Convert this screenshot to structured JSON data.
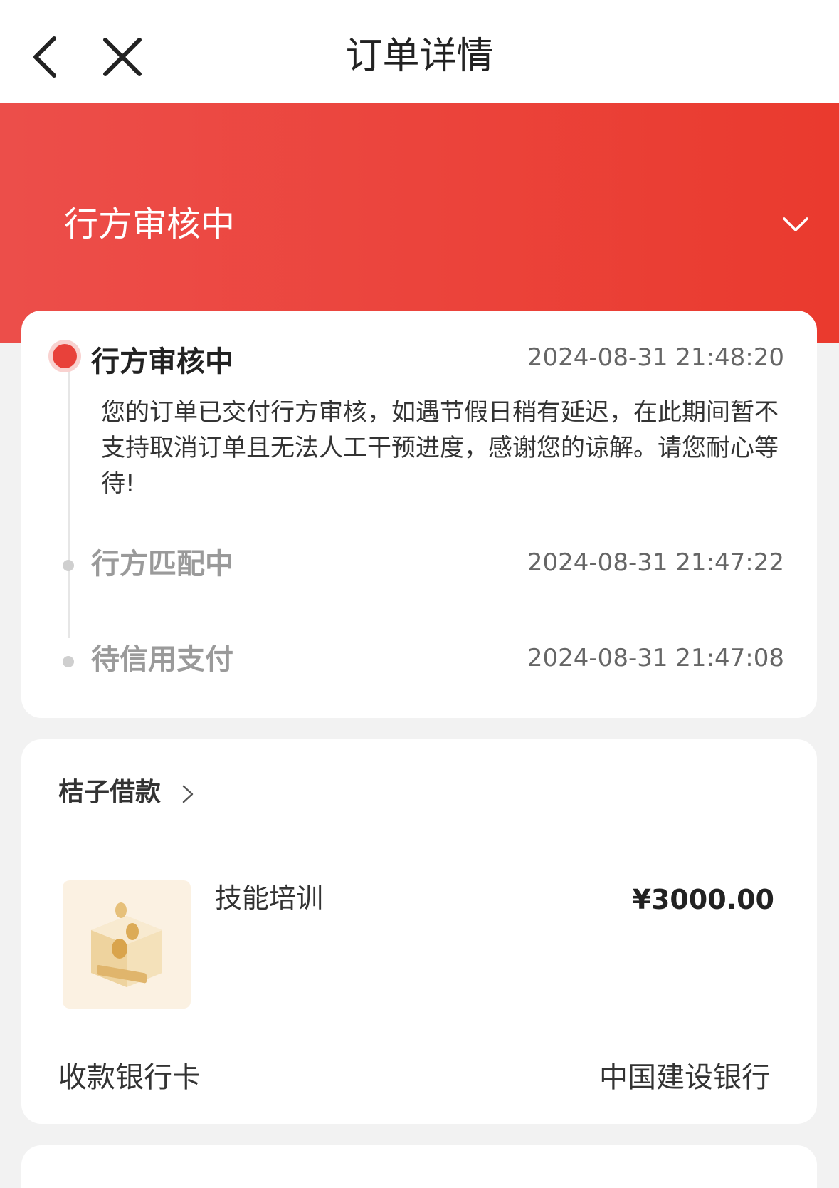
{
  "nav": {
    "title": "订单详情",
    "back_icon": "chevron-left-icon",
    "close_icon": "close-icon"
  },
  "banner": {
    "status": "行方审核中",
    "expand_icon": "chevron-down-icon",
    "color": "#ea3a2e"
  },
  "timeline": [
    {
      "title": "行方审核中",
      "time": "2024-08-31 21:48:20",
      "description": "您的订单已交付行方审核，如遇节假日稍有延迟，在此期间暂不支持取消订单且无法人工干预进度，感谢您的谅解。请您耐心等待!",
      "active": true
    },
    {
      "title": "行方匹配中",
      "time": "2024-08-31 21:47:22",
      "active": false
    },
    {
      "title": "待信用支付",
      "time": "2024-08-31 21:47:08",
      "active": false
    }
  ],
  "order": {
    "merchant": "桔子借款",
    "merchant_icon": "chevron-right-icon",
    "product_name": "技能培训",
    "product_icon": "coin-box-icon",
    "price": "¥3000.00",
    "bank_label": "收款银行卡",
    "bank_value": "中国建设银行"
  }
}
